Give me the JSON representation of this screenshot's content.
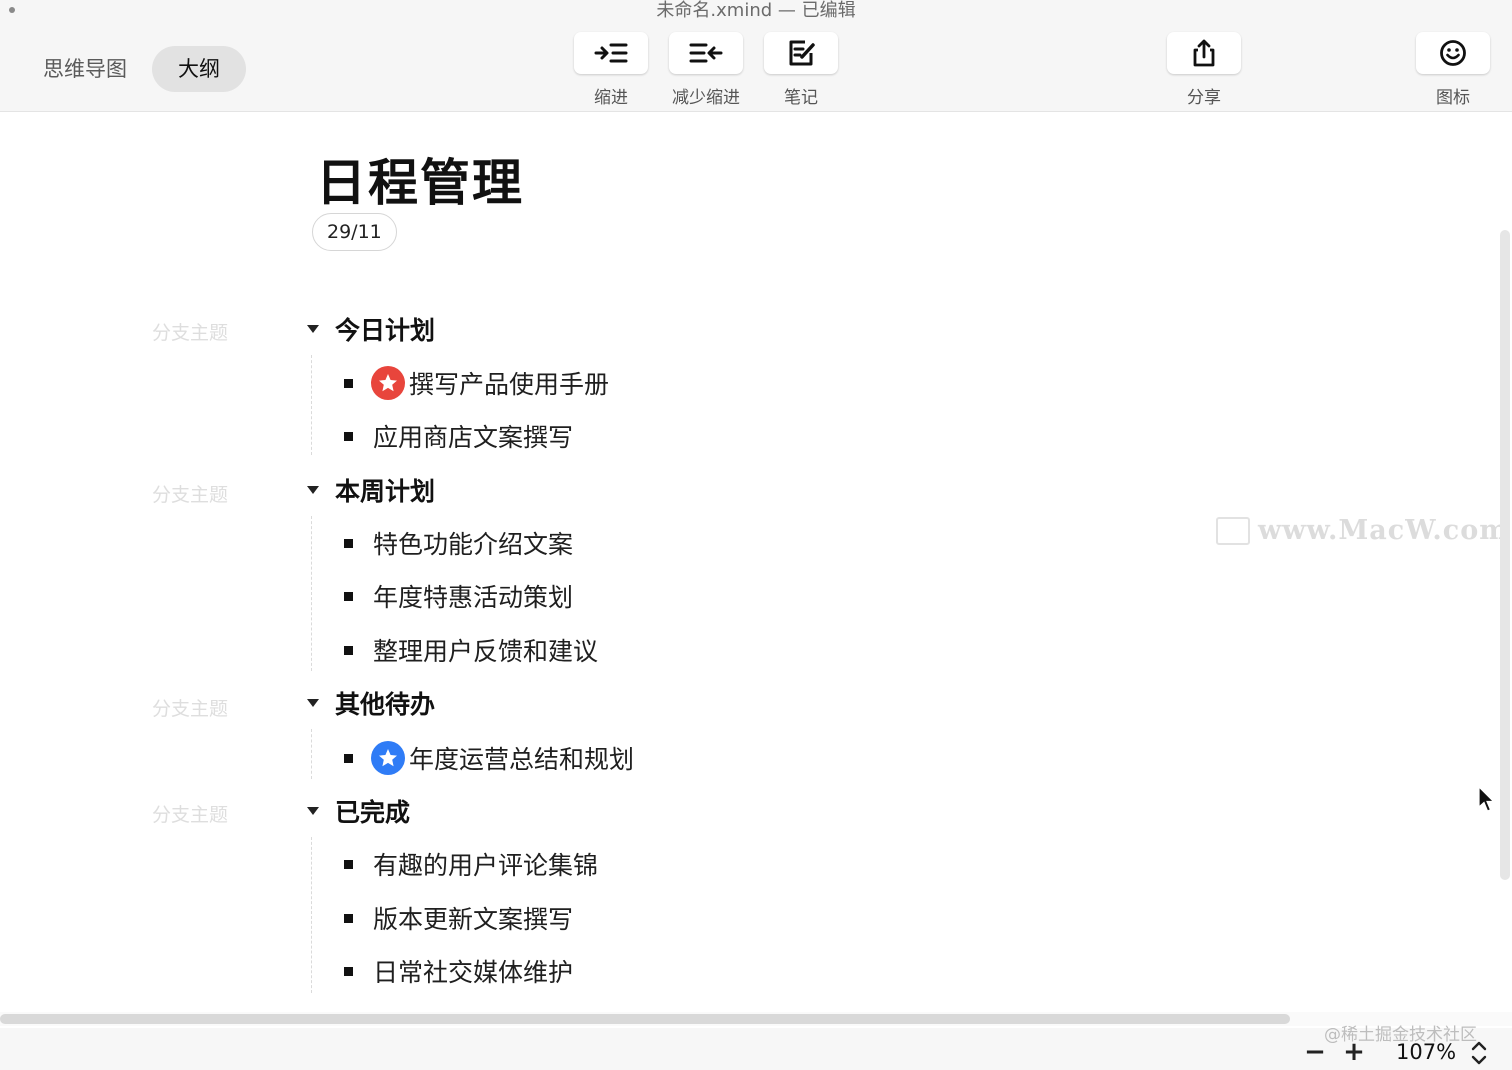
{
  "window": {
    "title": "未命名.xmind — 已编辑"
  },
  "view_switch": {
    "mindmap_label": "思维导图",
    "outline_label": "大纲",
    "active": "outline"
  },
  "toolbar": {
    "indent_label": "缩进",
    "outdent_label": "减少缩进",
    "note_label": "笔记",
    "share_label": "分享",
    "icon_label": "图标"
  },
  "document": {
    "title": "日程管理",
    "date": "29/11",
    "branch_hint": "分支主题",
    "branches": [
      {
        "label": "今日计划",
        "items": [
          {
            "label": "撰写产品使用手册",
            "marker": "star-red"
          },
          {
            "label": "应用商店文案撰写",
            "marker": null
          }
        ]
      },
      {
        "label": "本周计划",
        "items": [
          {
            "label": "特色功能介绍文案",
            "marker": null
          },
          {
            "label": "年度特惠活动策划",
            "marker": null
          },
          {
            "label": "整理用户反馈和建议",
            "marker": null
          }
        ]
      },
      {
        "label": "其他待办",
        "items": [
          {
            "label": "年度运营总结和规划",
            "marker": "star-blue"
          }
        ]
      },
      {
        "label": "已完成",
        "items": [
          {
            "label": "有趣的用户评论集锦",
            "marker": null
          },
          {
            "label": "版本更新文案撰写",
            "marker": null
          },
          {
            "label": "日常社交媒体维护",
            "marker": null
          }
        ]
      }
    ]
  },
  "watermark": {
    "text": "www.MacW.com"
  },
  "statusbar": {
    "credit": "@稀土掘金技术社区",
    "zoom": "107%",
    "zoom_out_symbol": "−",
    "zoom_in_symbol": "+"
  },
  "colors": {
    "star_red": "#e8453c",
    "star_blue": "#2f7cf6",
    "toolbar_bg": "#f6f6f6"
  },
  "icons": {
    "indent": "indent-icon",
    "outdent": "outdent-icon",
    "note": "note-edit-icon",
    "share": "share-icon",
    "emoji": "smiley-icon",
    "caret": "caret-down-icon"
  }
}
